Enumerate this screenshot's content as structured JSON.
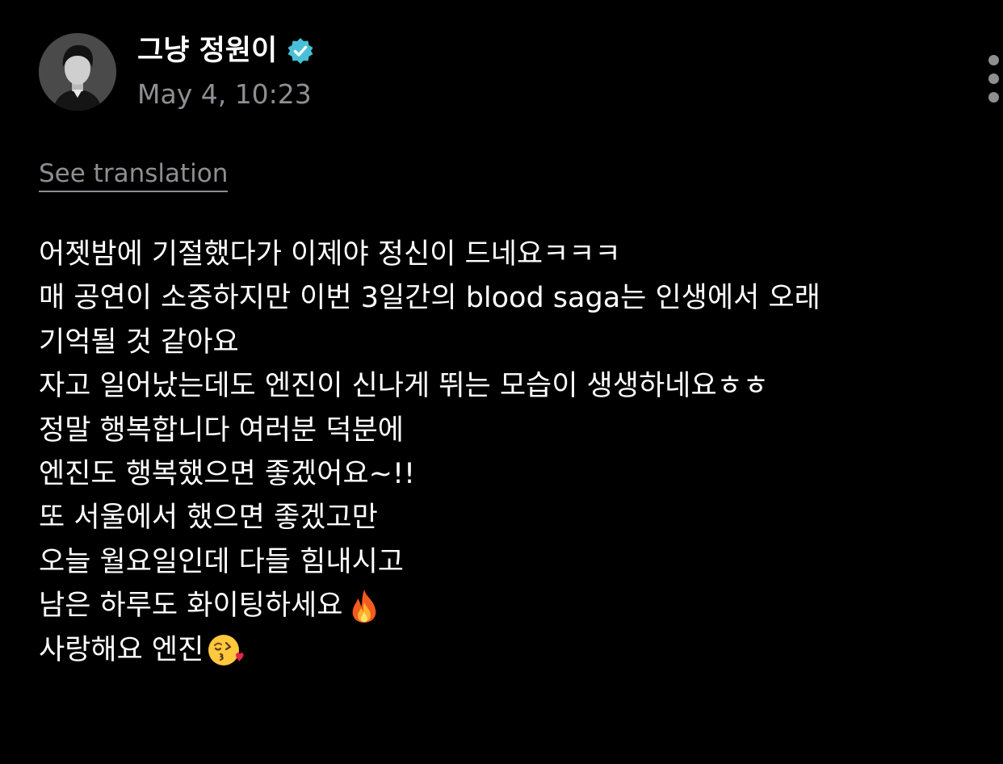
{
  "post": {
    "author_name": "그냥 정원이",
    "timestamp": "May 4, 10:23",
    "see_translation_label": "See translation",
    "icons": {
      "verified": "verified-badge-icon",
      "more": "more-vertical-icon",
      "fire_emoji": "fire-emoji-icon",
      "kiss_emoji": "face-blowing-kiss-emoji-icon"
    },
    "colors": {
      "background": "#000000",
      "text": "#ffffff",
      "secondary_text": "#8e8e93",
      "verified_badge": "#48c0d8"
    },
    "lines": [
      "어젯밤에 기절했다가 이제야 정신이 드네요ㅋㅋㅋ",
      "매 공연이 소중하지만 이번 3일간의 blood saga는 인생에서 오래",
      "기억될 것 같아요",
      "자고 일어났는데도 엔진이 신나게 뛰는 모습이 생생하네요ㅎㅎ",
      "정말 행복합니다 여러분 덕분에",
      "엔진도 행복했으면 좋겠어요~!!",
      "또 서울에서 했으면 좋겠고만",
      "오늘 월요일인데 다들 힘내시고",
      "남은 하루도 화이팅하세요",
      "사랑해요 엔진"
    ]
  }
}
